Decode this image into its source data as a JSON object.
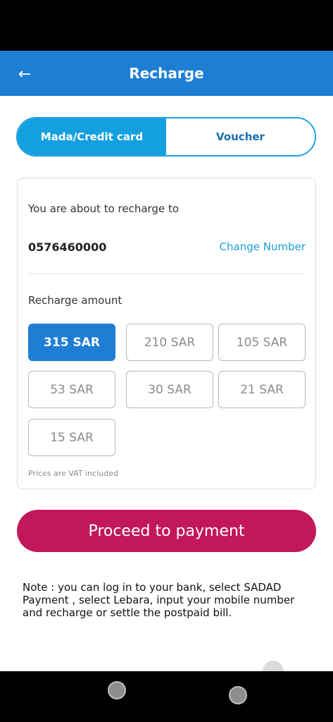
{
  "header": {
    "title": "Recharge",
    "back_icon": "arrow-left-icon"
  },
  "toggle": {
    "options": [
      "Mada/Credit card",
      "Voucher"
    ],
    "selected": "Mada/Credit card"
  },
  "recharge_target": {
    "label": "You are about to recharge to",
    "number": "0576460000",
    "change_link": "Change Number"
  },
  "amounts": {
    "label": "Recharge amount",
    "options": [
      "315 SAR",
      "210 SAR",
      "105 SAR",
      "53 SAR",
      "30 SAR",
      "21 SAR",
      "15 SAR"
    ],
    "selected": "315 SAR",
    "vat_note": "Prices are VAT included"
  },
  "proceed_label": "Proceed to payment",
  "note": "Note : you can log in to your bank, select SADAD Payment , select Lebara, input your mobile number and recharge or settle the postpaid bill.",
  "colors": {
    "header": "#1d7fd3",
    "toggle_active": "#14a0e0",
    "amount_selected": "#1f7ed4",
    "proceed": "#c2185b",
    "link": "#1ba0d6"
  }
}
